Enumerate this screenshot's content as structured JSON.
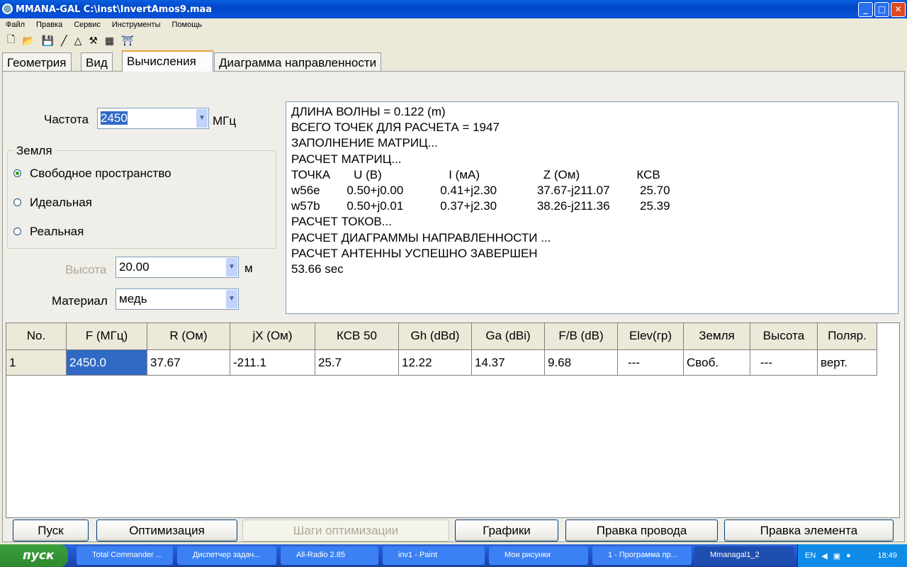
{
  "window": {
    "title": "MMANA-GAL C:\\inst\\InvertAmos9.maa",
    "min": "_",
    "max": "□",
    "close": "✕"
  },
  "menu": [
    "Файл",
    "Правка",
    "Сервис",
    "Инструменты",
    "Помощь"
  ],
  "toolbar_icons": [
    "new-file-icon",
    "open-folder-icon",
    "save-icon",
    "wire-icon",
    "triangle-icon",
    "tools-icon",
    "calculator-icon",
    "exit-icon"
  ],
  "tabs": [
    "Геометрия",
    "Вид",
    "Вычисления",
    "Диаграмма направленности"
  ],
  "freq": {
    "label": "Частота",
    "value": "2450",
    "unit": "МГц"
  },
  "ground": {
    "title": "Земля",
    "options": [
      "Свободное пространство",
      "Идеальная",
      "Реальная"
    ],
    "selected": 0
  },
  "height": {
    "label": "Высота",
    "value": "20.00",
    "unit": "м"
  },
  "material": {
    "label": "Материал",
    "value": "медь"
  },
  "output": [
    "ДЛИНА ВОЛНЫ = 0.122 (m)",
    "ВСЕГО ТОЧЕК ДЛЯ РАСЧЕТА = 1947",
    "ЗАПОЛНЕНИЕ МАТРИЦ...",
    "РАСЧЕТ МАТРИЦ...",
    "ТОЧКА       U (В)                    I (мА)                   Z (Ом)                 КСВ",
    "w56e        0.50+j0.00           0.41+j2.30            37.67-j211.07         25.70",
    "w57b        0.50+j0.01           0.37+j2.30            38.26-j211.36         25.39",
    "РАСЧЕТ ТОКОВ...",
    "РАСЧЕТ ДИАГРАММЫ НАПРАВЛЕННОСТИ ...",
    "РАСЧЕТ АНТЕННЫ УСПЕШНО ЗАВЕРШЕН",
    "53.66 sec"
  ],
  "table": {
    "headers": [
      "No.",
      "F (МГц)",
      "R (Ом)",
      "jX (Ом)",
      "КСВ 50",
      "Gh (dBd)",
      "Ga (dBi)",
      "F/B (dB)",
      "Elev(гр)",
      "Земля",
      "Высота",
      "Поляр."
    ],
    "rows": [
      [
        "1",
        "2450.0",
        "37.67",
        "-211.1",
        "25.7",
        "12.22",
        "14.37",
        "9.68",
        "---",
        "Своб.",
        "---",
        "верт."
      ]
    ]
  },
  "buttons": [
    "Пуск",
    "Оптимизация",
    "Шаги оптимизации",
    "Графики",
    "Правка провода",
    "Правка элемента"
  ],
  "taskbar": {
    "start": "пуск",
    "tasks": [
      "Total Commander ...",
      "Диспетчер задач...",
      "All-Radio 2.85",
      "inv1 - Paint",
      "Мои рисунки",
      "1 - Программа пр...",
      "Mmanagal1_2"
    ],
    "lang": "EN",
    "time": "18:49"
  }
}
